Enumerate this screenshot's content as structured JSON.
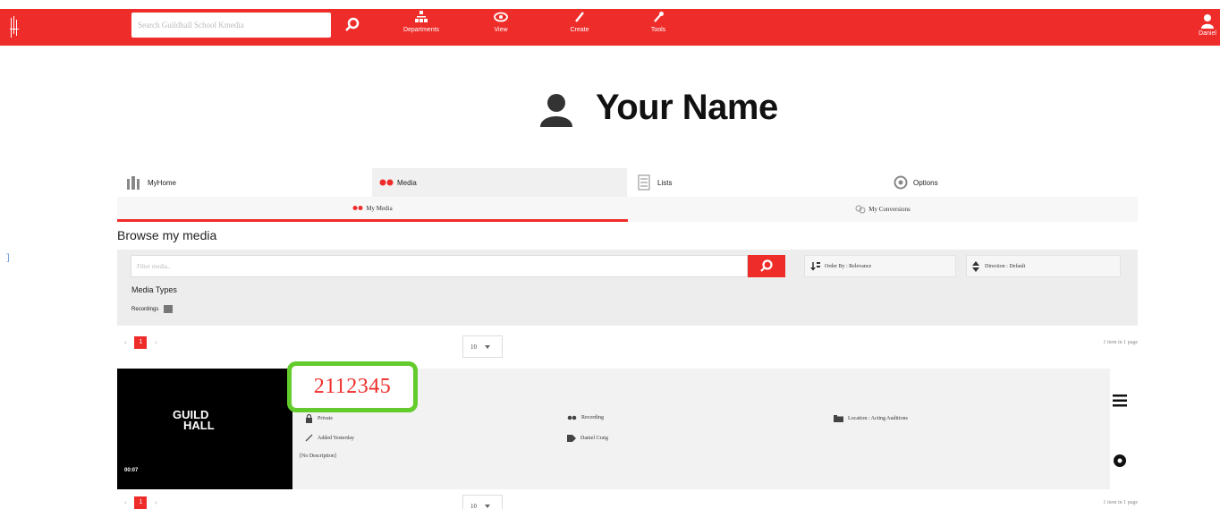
{
  "topbar": {
    "search_placeholder": "Search Guildhall School Kmedia",
    "nav": [
      {
        "label": "Departments",
        "icon": "sitemap-icon"
      },
      {
        "label": "View",
        "icon": "eye-icon"
      },
      {
        "label": "Create",
        "icon": "pencil-icon"
      },
      {
        "label": "Tools",
        "icon": "wrench-icon"
      }
    ],
    "user_label": "Daniel",
    "accent": "#ee2d2b"
  },
  "header": {
    "title": "Your Name"
  },
  "tabs": [
    {
      "label": "MyHome",
      "icon": "home-icon"
    },
    {
      "label": "Media",
      "icon": "media-icon",
      "active": true
    },
    {
      "label": "Lists",
      "icon": "list-icon"
    },
    {
      "label": "Options",
      "icon": "gear-icon"
    }
  ],
  "subtabs": [
    {
      "label": "My Media",
      "icon": "media-icon",
      "active": true
    },
    {
      "label": "My Conversions",
      "icon": "conversions-icon"
    }
  ],
  "browse": {
    "title": "Browse my media",
    "filter_placeholder": "Filter media..",
    "order_by": "Order By : Relevance",
    "direction": "Direction : Default",
    "media_types_label": "Media Types",
    "media_type_option": "Recordings"
  },
  "pagination": {
    "prev": "‹",
    "current": "1",
    "next": "›",
    "page_size": "10",
    "items_count": "1 item in 1 page"
  },
  "entry": {
    "id": "2112345",
    "duration": "00:07",
    "thumb_logo_line1": "GUILD",
    "thumb_logo_line2": "HALL",
    "privacy": "Private",
    "added": "Added Yesterday",
    "description": "[No Description]",
    "type": "Recording",
    "owner": "Daniel Craig",
    "location": "Location : Acting Auditions"
  },
  "side_mark": "]"
}
